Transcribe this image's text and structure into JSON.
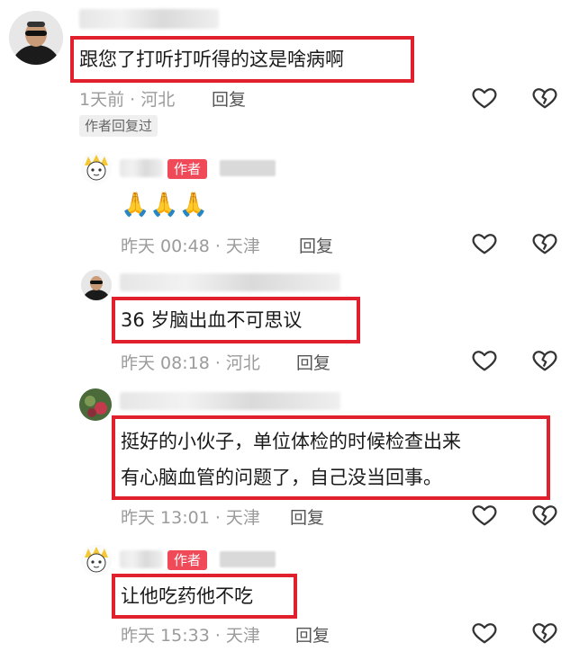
{
  "comments": [
    {
      "text": "跟您了打听打听得的这是啥病啊",
      "meta": "1天前 · 河北",
      "reply_label": "回复",
      "author_replied_tag": "作者回复过",
      "avatar_icon": "man-sunglasses-avatar"
    },
    {
      "author_badge": "作者",
      "text": "🙏🙏🙏",
      "meta": "昨天 00:48 · 天津",
      "reply_label": "回复",
      "avatar_icon": "cartoon-avatar"
    },
    {
      "text": "36 岁脑出血不可思议",
      "meta": "昨天 08:18 · 河北",
      "reply_label": "回复",
      "avatar_icon": "man-sunglasses-avatar"
    },
    {
      "text_line1": "挺好的小伙子，单位体检的时候检查出来",
      "text_line2": "有心脑血管的问题了，自己没当回事。",
      "meta": "昨天 13:01 · 天津",
      "reply_label": "回复",
      "avatar_icon": "flower-avatar"
    },
    {
      "author_badge": "作者",
      "text": "让他吃药他不吃",
      "meta": "昨天 15:33 · 天津",
      "reply_label": "回复",
      "avatar_icon": "cartoon-avatar"
    }
  ],
  "colors": {
    "highlight": "#e0202c",
    "author_badge": "#f04a59",
    "meta": "#9b9b9b"
  }
}
